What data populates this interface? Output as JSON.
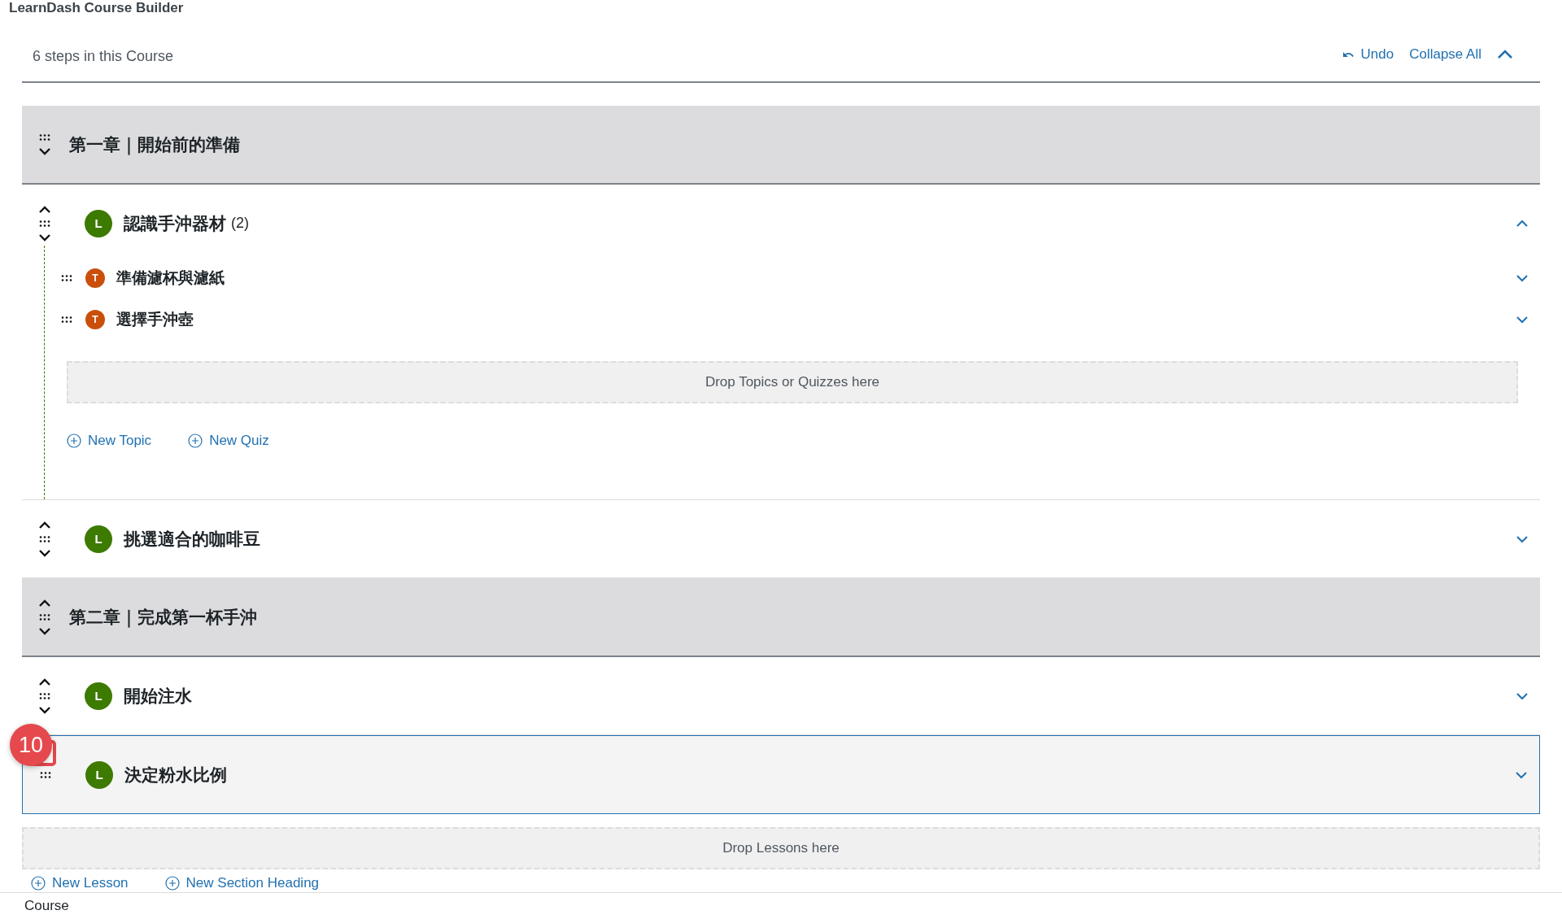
{
  "page_title": "LearnDash Course Builder",
  "header": {
    "steps": "6 steps in this Course",
    "undo": "Undo",
    "collapse_all": "Collapse All"
  },
  "items": [
    {
      "kind": "section",
      "title": "第一章｜開始前的準備",
      "can_move_up": false,
      "can_move_down": true
    },
    {
      "kind": "lesson",
      "badge": "L",
      "title": "認識手沖器材",
      "count": "(2)",
      "can_move_up": true,
      "can_move_down": true,
      "expanded": true,
      "highlighted": false,
      "children": [
        {
          "badge": "T",
          "title": "準備濾杯與濾紙"
        },
        {
          "badge": "T",
          "title": "選擇手沖壺"
        }
      ],
      "drop_zone": "Drop Topics or Quizzes here",
      "links": [
        "New Topic",
        "New Quiz"
      ]
    },
    {
      "kind": "lesson",
      "badge": "L",
      "title": "挑選適合的咖啡豆",
      "can_move_up": true,
      "can_move_down": true,
      "expanded": false,
      "highlighted": false
    },
    {
      "kind": "section",
      "title": "第二章｜完成第一杯手沖",
      "can_move_up": true,
      "can_move_down": true
    },
    {
      "kind": "lesson",
      "badge": "L",
      "title": "開始注水",
      "can_move_up": true,
      "can_move_down": true,
      "expanded": false,
      "highlighted": false
    },
    {
      "kind": "lesson",
      "badge": "L",
      "title": "決定粉水比例",
      "can_move_up": false,
      "can_move_down": false,
      "expanded": false,
      "highlighted": true,
      "marker": "10"
    }
  ],
  "drop_zone": "Drop Lessons here",
  "links": [
    "New Lesson",
    "New Section Heading"
  ],
  "footer": "Course"
}
